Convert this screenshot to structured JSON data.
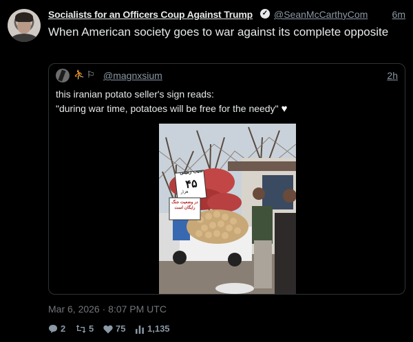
{
  "author": {
    "display_name": "Socialists for an Officers Coup Against Trump",
    "handle": "@SeanMcCarthyCom",
    "time": "6m",
    "verified_icon": "verified-badge-icon"
  },
  "tweet": {
    "text": "When American society goes to war against its complete opposite"
  },
  "quote": {
    "handle": "@magnxsium",
    "time": "2h",
    "line1": "this iranian potato seller's sign reads:",
    "line2": "\"during war time, potatoes will be free for the needy\"",
    "heart": "♥",
    "emoji1": "⛹",
    "emoji2": "⚐",
    "sign_number": "۴۵",
    "sign_unit": "هزار",
    "sign_top": "سیب زمینی",
    "sign_bottom": "در وضعیت جنگ رایگان است"
  },
  "footer": {
    "date": "Mar 6, 2026 · 8:07 PM UTC"
  },
  "stats": {
    "replies": "2",
    "retweets": "5",
    "likes": "75",
    "views": "1,135"
  },
  "colors": {
    "background": "#000000",
    "text": "#e7e9ea",
    "muted": "#8b98a5",
    "border": "#2f3336"
  }
}
